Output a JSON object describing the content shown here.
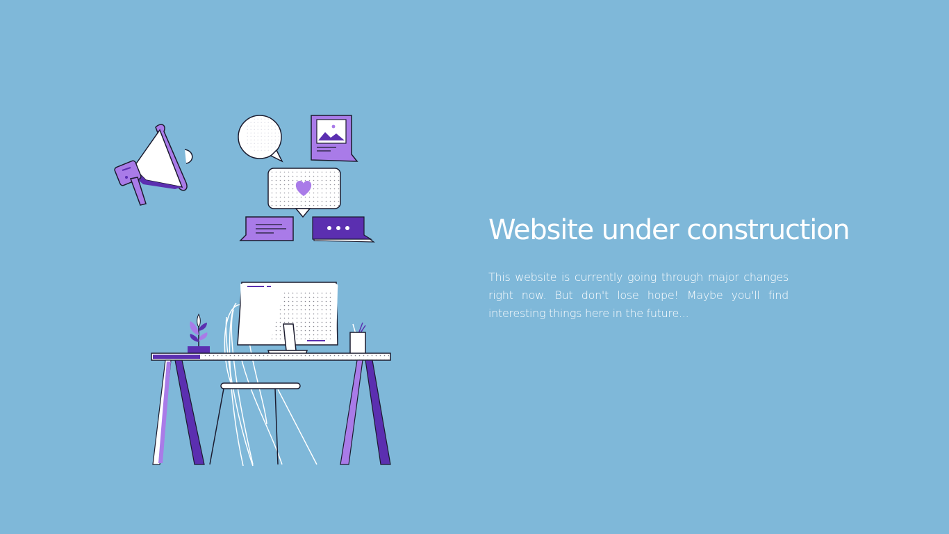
{
  "hero": {
    "heading": "Website under construction",
    "description": "This website is currently going through major changes right now. But don't lose hope! Maybe you'll find interesting things here in the future..."
  },
  "illustration": {
    "icons": [
      "megaphone-icon",
      "speech-bubble-icon",
      "image-card-icon",
      "heart-message-icon",
      "text-message-icon",
      "typing-bubble-icon",
      "monitor-icon",
      "desk-icon",
      "chair-icon",
      "plant-icon",
      "pencil-cup-icon"
    ]
  },
  "colors": {
    "background": "#7fb8d9",
    "purple_dark": "#5b2fb0",
    "purple_light": "#a97be8",
    "white": "#ffffff",
    "outline": "#1b1b2e"
  }
}
